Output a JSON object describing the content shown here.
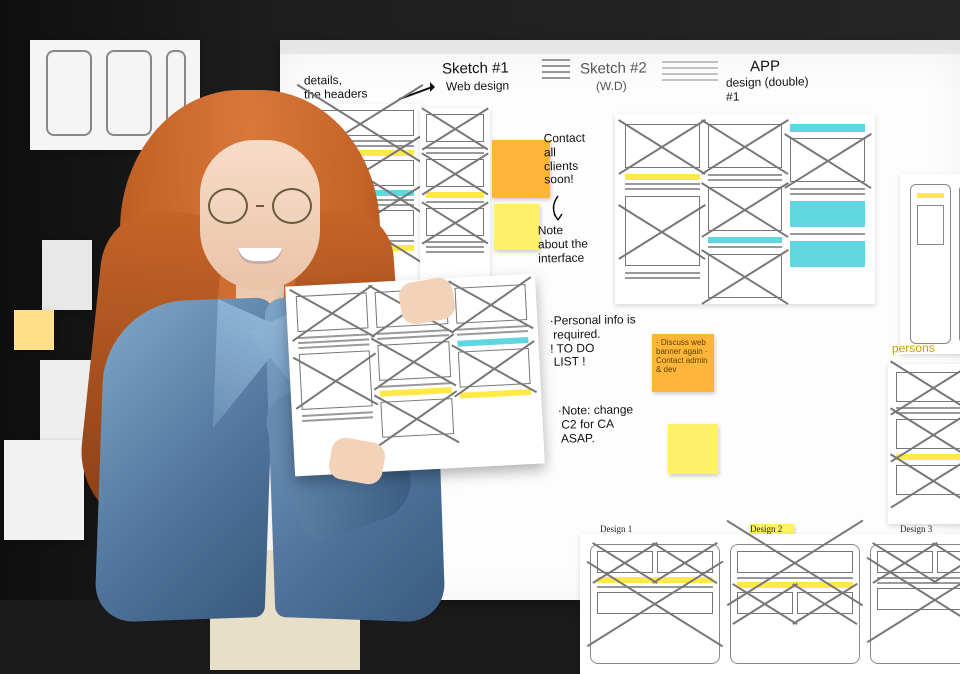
{
  "board": {
    "sketch1_title": "Sketch #1",
    "sketch1_sub": "Web design",
    "sketch2_title": "Sketch #2",
    "sketch2_sub": "(W.D)",
    "app_title": "APP",
    "app_sub": "design (double)\n#1",
    "details_note": "details,\nthe headers",
    "contact_note": "Contact\nall\nclients\nsoon!",
    "note_interface": "Note\nabout the\ninterface",
    "todo_header": "·Personal info is\n required.\n! TO DO\n LIST !",
    "note_change": "·Note: change\n C2 for CA\n ASAP.",
    "bottom_label_1": "Design 1",
    "bottom_label_2": "Design 2",
    "bottom_label_3": "Design 3",
    "persons_tag": "persons"
  },
  "stickies": {
    "orange1": "",
    "yellow1": "",
    "orange2": "· Discuss web\n  banner again\n· Contact\n  admin & dev",
    "yellow2": "",
    "yellow3": ""
  },
  "colors": {
    "sticky_orange": "#ffb43a",
    "sticky_yellow": "#fff06a",
    "hl_yellow": "#ffe94a",
    "hl_cyan": "#5fd6e0",
    "denim": "#4f739b",
    "hair": "#c56428"
  }
}
